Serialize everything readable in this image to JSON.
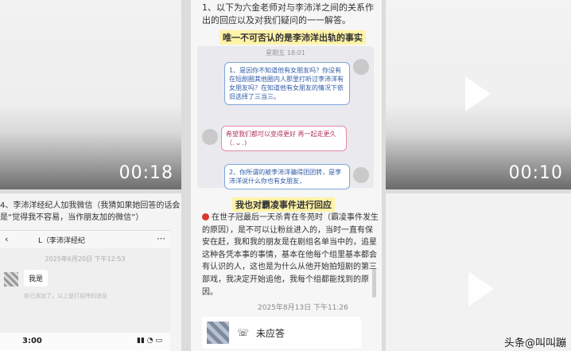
{
  "tiles": {
    "top_left": {
      "duration": "00:18"
    },
    "top_right": {
      "duration": "00:10"
    }
  },
  "center": {
    "intro": "1、以下为六金老师对与李沛洋之间的关系作出的回应以及对我们疑问的一一解答。",
    "highlight_1": "唯一不可否认的是李沛洋出轨的事实",
    "chat_time": "星期五 18:01",
    "bubble_1": "1、是因你不知道他有女朋友吗？你没有在短剧圈其他圈内人那里打听过李沛洋有女朋友吗？在知道他有女朋友的情况下依旧选择了三当三。",
    "bubble_2": "希望我们都可以变得更好 再一起走更久（. ᴗ .)",
    "bubble_3": "2、你所谓的被李沛洋骗得团团转，是李沛洋说什么你也有女朋友，",
    "highlight_2": "我也对霸凌事件进行回应",
    "paragraph": "在世子冠最后一天杀青在冬苑时（霸凌事件发生的原因），是不可以让粉丝进入的，当时一直有保安在赶，我和我的朋友是在剧组名单当中的，追星这种各凭本事的事情，基本在他每个组里基本都会有认识的人，这也是为什么从他开始拍短剧的第三部戏，我决定开始追他，我每个组都能找到的原因。",
    "timestamp": "2025年8月13日 下午11:26",
    "call_status": "未应答"
  },
  "bottom_left": {
    "caption": "4、李沛洋经纪人加我微信（我猜如果她回答的话会是“觉得我不容易，当作朋友加的微信”）",
    "chat_title": "L（李沛洋经纪",
    "date": "2025年6月20日 下午12:53",
    "message": "我是",
    "note": "你已添加了，以上是打招呼的消息",
    "status_time": "3:00"
  },
  "watermark": "头条@叫叫蹦"
}
